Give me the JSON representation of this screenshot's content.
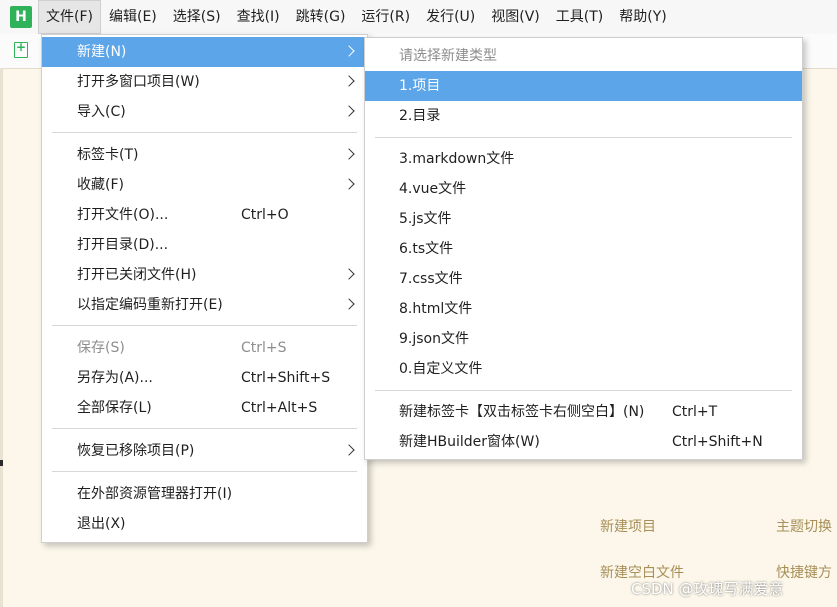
{
  "menubar": {
    "items": [
      {
        "label": "文件(F)"
      },
      {
        "label": "编辑(E)"
      },
      {
        "label": "选择(S)"
      },
      {
        "label": "查找(I)"
      },
      {
        "label": "跳转(G)"
      },
      {
        "label": "运行(R)"
      },
      {
        "label": "发行(U)"
      },
      {
        "label": "视图(V)"
      },
      {
        "label": "工具(T)"
      },
      {
        "label": "帮助(Y)"
      }
    ],
    "logo": "H"
  },
  "file_menu": {
    "items": [
      {
        "label": "新建(N)"
      },
      {
        "label": "打开多窗口项目(W)"
      },
      {
        "label": "导入(C)"
      },
      {
        "label": "标签卡(T)"
      },
      {
        "label": "收藏(F)"
      },
      {
        "label": "打开文件(O)...",
        "shortcut": "Ctrl+O"
      },
      {
        "label": "打开目录(D)..."
      },
      {
        "label": "打开已关闭文件(H)"
      },
      {
        "label": "以指定编码重新打开(E)"
      },
      {
        "label": "保存(S)",
        "shortcut": "Ctrl+S"
      },
      {
        "label": "另存为(A)...",
        "shortcut": "Ctrl+Shift+S"
      },
      {
        "label": "全部保存(L)",
        "shortcut": "Ctrl+Alt+S"
      },
      {
        "label": "恢复已移除项目(P)"
      },
      {
        "label": "在外部资源管理器打开(I)"
      },
      {
        "label": "退出(X)"
      }
    ]
  },
  "new_submenu": {
    "hint": "请选择新建类型",
    "items": [
      {
        "label": "1.项目"
      },
      {
        "label": "2.目录"
      },
      {
        "label": "3.markdown文件"
      },
      {
        "label": "4.vue文件"
      },
      {
        "label": "5.js文件"
      },
      {
        "label": "6.ts文件"
      },
      {
        "label": "7.css文件"
      },
      {
        "label": "8.html文件"
      },
      {
        "label": "9.json文件"
      },
      {
        "label": "0.自定义文件"
      },
      {
        "label": "新建标签卡【双击标签卡右侧空白】(N)",
        "shortcut": "Ctrl+T"
      },
      {
        "label": "新建HBuilder窗体(W)",
        "shortcut": "Ctrl+Shift+N"
      }
    ]
  },
  "welcome": {
    "new_project": "新建项目",
    "theme_switch": "主题切换",
    "new_blank_file": "新建空白文件",
    "shortcuts": "快捷键方"
  },
  "watermark": "CSDN @玫瑰写满爱意",
  "colors": {
    "highlight": "#5ca5e8",
    "background": "#fcf7ea",
    "brand": "#2fb25a"
  }
}
